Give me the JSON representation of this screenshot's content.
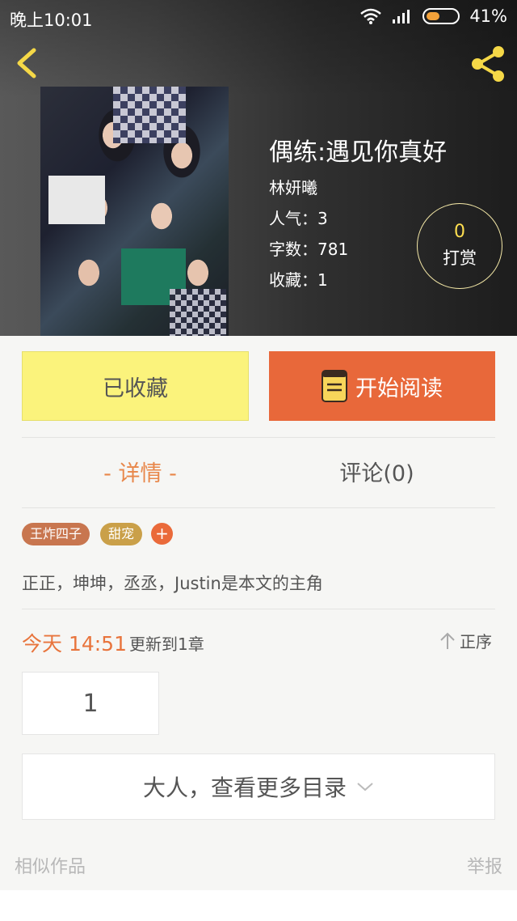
{
  "status_bar": {
    "time": "晚上10:01",
    "battery_percent": "41%"
  },
  "book": {
    "title": "偶练:遇见你真好",
    "author": "林妍曦",
    "popularity": "人气：3",
    "word_count": "字数：781",
    "favorites": "收藏：1"
  },
  "tip": {
    "count": "0",
    "label": "打赏"
  },
  "actions": {
    "collected_label": "已收藏",
    "read_label": "开始阅读"
  },
  "tabs": {
    "detail": "- 详情 -",
    "comments": "评论(0)"
  },
  "tags": [
    "王炸四子",
    "甜宠"
  ],
  "tag_add": "+",
  "description": "正正，坤坤，丞丞，Justin是本文的主角",
  "update": {
    "time": "今天 14:51",
    "text": "更新到1章",
    "sort_label": "正序"
  },
  "chapters": [
    "1"
  ],
  "more_catalog": "大人，查看更多目录",
  "footer": {
    "similar": "相似作品",
    "report": "举报"
  },
  "colors": {
    "accent_orange": "#e8683a",
    "collected_yellow": "#fbf37c",
    "icon_yellow": "#f5d847"
  }
}
